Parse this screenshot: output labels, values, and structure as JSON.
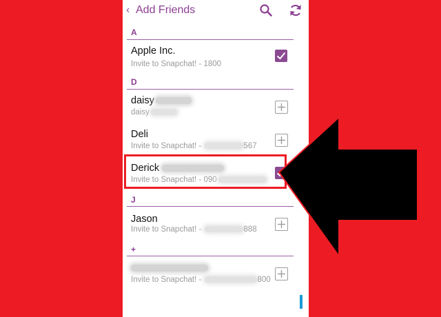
{
  "header": {
    "back_glyph": "‹",
    "title": "Add Friends",
    "icons": [
      "search-icon",
      "refresh-icon"
    ]
  },
  "sections": [
    {
      "letter": "A",
      "contacts": [
        {
          "name": "Apple Inc.",
          "sub": "Invite to Snapchat! - 1800",
          "state": "checked"
        }
      ]
    },
    {
      "letter": "D",
      "contacts": [
        {
          "name": "daisy",
          "sub": "daisy",
          "state": "add"
        },
        {
          "name": "Deli",
          "sub_prefix": "Invite to Snapchat! - ",
          "sub_suffix": "567",
          "state": "add"
        },
        {
          "name": "Derick",
          "sub_prefix": "Invite to Snapchat! - 090",
          "state": "checked",
          "highlighted": true
        }
      ]
    },
    {
      "letter": "J",
      "contacts": [
        {
          "name": "Jason",
          "sub_prefix": "Invite to Snapchat! - ",
          "sub_suffix": "888",
          "state": "add"
        }
      ]
    },
    {
      "letter": "+",
      "contacts": [
        {
          "name": "",
          "sub_prefix": "Invite to Snapchat! - ",
          "sub_suffix": "800",
          "state": "add"
        }
      ]
    }
  ],
  "colors": {
    "background": "#ed1c24",
    "accent": "#8b3f92",
    "checkbox": "#8b4a92",
    "scrollbar": "#1a9ad6",
    "arrow": "#000000"
  }
}
